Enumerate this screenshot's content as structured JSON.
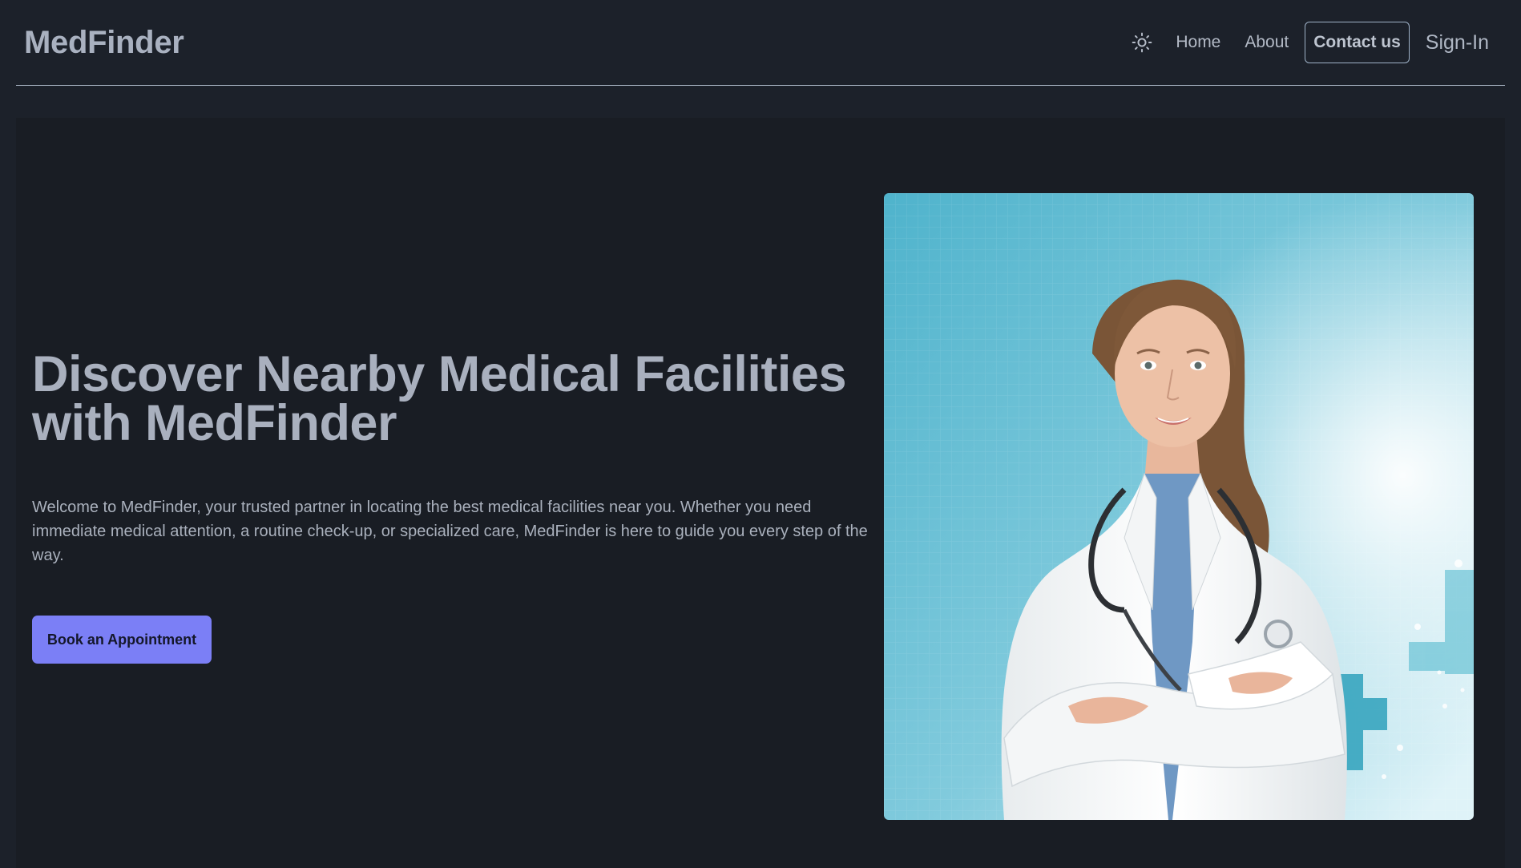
{
  "navbar": {
    "brand": "MedFinder",
    "theme_icon": "sun-icon",
    "links": {
      "home": "Home",
      "about": "About",
      "contact": "Contact us",
      "signin": "Sign-In"
    }
  },
  "hero": {
    "title": "Discover Nearby Medical Facilities with MedFinder",
    "description": "Welcome to MedFinder, your trusted partner in locating the best medical facilities near you. Whether you need immediate medical attention, a routine check-up, or specialized care, MedFinder is here to guide you every step of the way.",
    "cta_label": "Book an Appointment",
    "image_alt": "Smiling doctor in white coat with stethoscope, arms crossed"
  },
  "colors": {
    "background": "#1c212a",
    "hero_background": "#191d24",
    "accent": "#7b7ff6",
    "text": "#a9b0be",
    "border": "#a9b5c4"
  }
}
